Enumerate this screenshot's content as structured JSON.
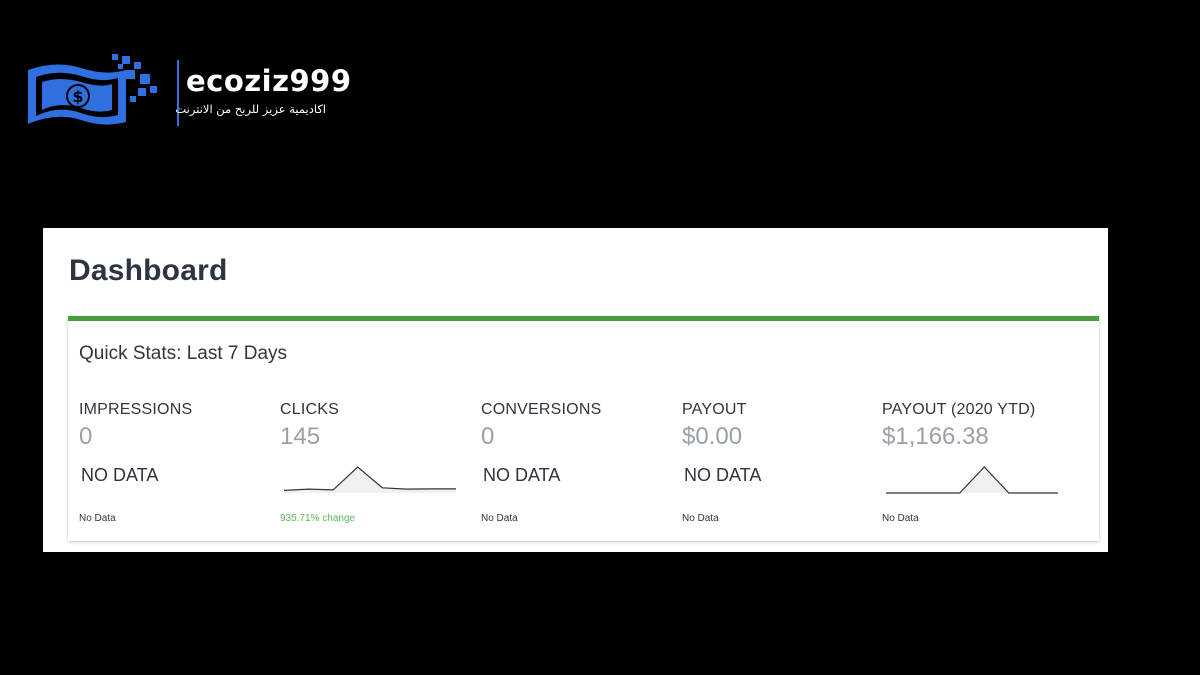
{
  "brand": {
    "name": "ecoziz999",
    "tagline": "اكاديمية عزيز للربح من الانترنت",
    "logo_icon": "dollar-bill-icon",
    "color": "#2f6fe0"
  },
  "dashboard": {
    "title": "Dashboard",
    "accent_color": "#4a9a3f",
    "quick_stats": {
      "title": "Quick Stats: Last 7 Days",
      "stats": [
        {
          "label": "IMPRESSIONS",
          "value": "0",
          "status": "NO DATA",
          "footer": "No Data"
        },
        {
          "label": "CLICKS",
          "value": "145",
          "status": "",
          "footer": "935.71% change",
          "trend": [
            0.1,
            0.15,
            0.12,
            1.0,
            0.2,
            0.15,
            0.16,
            0.16
          ]
        },
        {
          "label": "CONVERSIONS",
          "value": "0",
          "status": "NO DATA",
          "footer": "No Data"
        },
        {
          "label": "PAYOUT",
          "value": "$0.00",
          "status": "NO DATA",
          "footer": "No Data"
        },
        {
          "label": "PAYOUT (2020 YTD)",
          "value": "$1,166.38",
          "status": "",
          "footer": "No Data",
          "trend": [
            0,
            0,
            0,
            0,
            1.0,
            0,
            0,
            0
          ]
        }
      ]
    }
  }
}
